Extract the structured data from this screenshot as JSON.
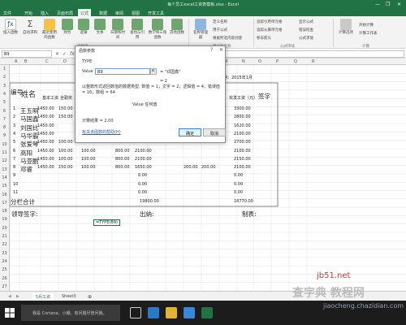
{
  "window": {
    "title": "每个员工excel工资表模板.xlsx - Excel",
    "minimize": "—",
    "restore": "❐",
    "close": "✕"
  },
  "ribbon_tabs": [
    "文件",
    "开始",
    "插入",
    "页面布局",
    "公式",
    "数据",
    "审阅",
    "视图",
    "开发工具"
  ],
  "active_tab": "公式",
  "ribbon": {
    "buttons": [
      "插入函数",
      "自动求和",
      "最近使用的函数",
      "财务",
      "逻辑",
      "文本",
      "日期和时间",
      "查找与引用",
      "数学和三角函数",
      "其他函数",
      "名称管理器",
      "计算选项"
    ],
    "small": [
      "定义名称",
      "用于公式",
      "根据所选内容创建",
      "追踪引用单元格",
      "追踪从属单元格",
      "移去箭头",
      "显示公式",
      "错误检查",
      "公式求值",
      "开始计算",
      "计算工作表"
    ],
    "groups": [
      "函数库",
      "定义的名称",
      "公式审核",
      "计算"
    ],
    "brand_color": "#217346"
  },
  "formula_bar": {
    "name_box": "B9",
    "fx": "fx",
    "formula": "=TYPE(B9)"
  },
  "columns": [
    "A",
    "B",
    "C",
    "D",
    "E",
    "F",
    "G",
    "H",
    "I",
    "J",
    "K",
    "L",
    "M",
    "N",
    "O",
    "P",
    "Q",
    "R"
  ],
  "rows": [
    "1",
    "2",
    "3",
    "4",
    "5",
    "6",
    "7",
    "8",
    "9",
    "10",
    "11",
    "12",
    "13",
    "14",
    "15",
    "16",
    "17",
    "18",
    "19",
    "20",
    "21",
    "22",
    "23",
    "24",
    "25",
    "26",
    "27"
  ],
  "sheet": {
    "header_no": "编号",
    "header_name": "姓名",
    "header_base": "基本工资",
    "header_bonus": "全勤奖",
    "header_actual": "实发工资（元）",
    "header_sign": "签字",
    "month_label": "制表日期：2015年1月",
    "employees": [
      {
        "no": "1",
        "name": "王五明",
        "base": "1450.00",
        "bonus": "150.00",
        "actual": "3300.00"
      },
      {
        "no": "2",
        "name": "马国鑫",
        "base": "1450.00",
        "bonus": "150.00",
        "actual": "2800.00"
      },
      {
        "no": "3",
        "name": "刘国比",
        "base": "1450.00",
        "bonus": "",
        "actual": "1620.00"
      },
      {
        "no": "4",
        "name": "马华霸",
        "base": "1450.00",
        "bonus": "",
        "actual": "2100.00"
      },
      {
        "no": "5",
        "name": "张爱琴",
        "base": "1450.00",
        "bonus": "100.00",
        "actual": "2700.00"
      },
      {
        "no": "6",
        "name": "高阳",
        "base": "1450.00",
        "bonus": "100.00",
        "actual": "2100.00"
      },
      {
        "no": "7",
        "name": "马亚鹏",
        "base": "1450.00",
        "bonus": "100.00",
        "actual": "2150.00"
      },
      {
        "no": "8",
        "name": "邓睿",
        "base": "1450.00",
        "bonus": "150.00",
        "actual": "2100.00"
      },
      {
        "no": "9",
        "name": "",
        "base": "",
        "bonus": "",
        "actual": "0.00"
      },
      {
        "no": "10",
        "name": "",
        "base": "",
        "bonus": "",
        "actual": "0.00"
      },
      {
        "no": "11",
        "name": "",
        "base": "",
        "bonus": "",
        "actual": "0.00"
      }
    ],
    "row5_extra": [
      "100.00",
      "800.00",
      "2100.00"
    ],
    "row6_extra": [
      "100.00",
      "800.00",
      "2100.00"
    ],
    "row7_extra": [
      "100.00",
      "800.00",
      "2100.00"
    ],
    "row8_extra": [
      "100.00",
      "800.00",
      "1650.00",
      "200.00",
      "200.00"
    ],
    "mid_zeros": [
      "0.00",
      "0.00",
      "0.00"
    ],
    "subtotal_label": "分栏合计",
    "subtotal_mid": "19800.00",
    "subtotal_actual": "18770.00",
    "footer_leader": "领导签字:",
    "footer_cashier": "出纳:",
    "footer_maker": "制表:",
    "active_formula_cell": "=TYPE(B9)"
  },
  "dialog": {
    "title": "函数参数",
    "help": "?",
    "close": "✕",
    "func_name": "TYPE",
    "arg_label": "Value",
    "arg_value": "B9",
    "arg_result": "= \"邓国鑫\"",
    "func_result": "= 2",
    "description": "以整数形式返回数值的数据类型: 数值 = 1；文字 = 2；逻辑值 = 4；错误值 = 16；数组 = 64",
    "value_desc": "Value  任何值",
    "calc_result": "计算结果 =  2.00",
    "help_link": "有关该函数的帮助(H)",
    "ok": "确定",
    "cancel": "取消"
  },
  "sheet_tabs": [
    "5月工资",
    "Sheet3"
  ],
  "taskbar": {
    "search_text": "我是 Cortana，小娜。有问题尽管问我。"
  },
  "watermark": {
    "site": "jb51.net",
    "cn": "查字典 教程网",
    "url": "jiaocheng.chazidian.com"
  }
}
